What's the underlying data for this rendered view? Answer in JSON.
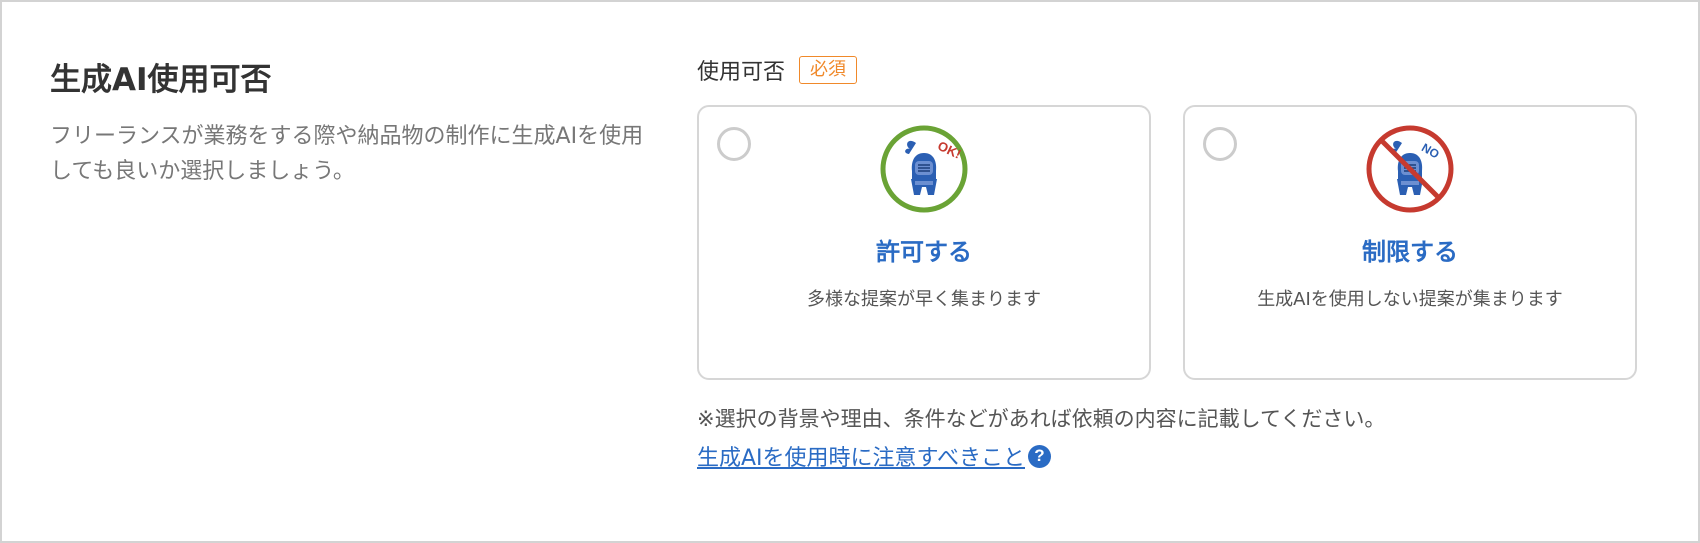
{
  "section": {
    "title": "生成AI使用可否",
    "description": "フリーランスが業務をする際や納品物の制作に生成AIを使用しても良いか選択しましょう。"
  },
  "field": {
    "label": "使用可否",
    "required_badge": "必須"
  },
  "options": [
    {
      "title": "許可する",
      "subtitle": "多様な提案が早く集まります",
      "badge_text": "OK!",
      "ring_color": "#6aa335",
      "selected": false
    },
    {
      "title": "制限する",
      "subtitle": "生成AIを使用しない提案が集まります",
      "badge_text": "NO",
      "ring_color": "#c63a2f",
      "selected": false
    }
  ],
  "note": "※選択の背景や理由、条件などがあれば依頼の内容に記載してください。",
  "help_link": {
    "label": "生成AIを使用時に注意すべきこと",
    "icon": "question-circle-icon",
    "icon_glyph": "?"
  },
  "colors": {
    "accent_blue": "#2a6bc4",
    "required_orange": "#f0892a",
    "card_border": "#d6d6d6"
  }
}
